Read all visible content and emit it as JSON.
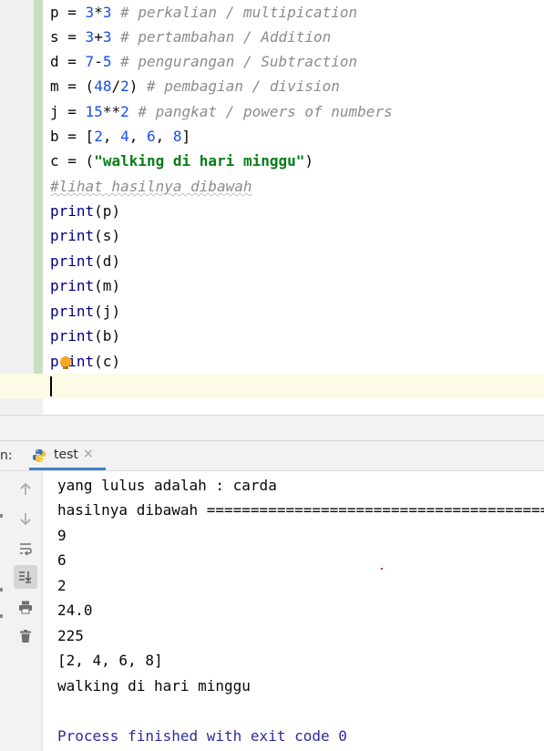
{
  "editor": {
    "lines": [
      {
        "var": "p",
        "eq": " = ",
        "expr_a": "3",
        "op": "*",
        "expr_b": "3",
        "comment": " # perkalian / multipication"
      },
      {
        "var": "s",
        "eq": " = ",
        "expr_a": "3",
        "op": "+",
        "expr_b": "3",
        "comment": " # pertambahan / Addition"
      },
      {
        "var": "d",
        "eq": " = ",
        "expr_a": "7",
        "op": "-",
        "expr_b": "5",
        "comment": " # pengurangan / Subtraction"
      },
      {
        "var": "m",
        "eq": " = ",
        "open": "(",
        "expr_a": "48",
        "op": "/",
        "expr_b": "2",
        "close": ")",
        "comment": " # pembagian / division"
      },
      {
        "var": "j",
        "eq": " = ",
        "expr_a": "15",
        "op": "**",
        "expr_b": "2",
        "comment": " # pangkat / powers of numbers"
      },
      {
        "var": "b",
        "eq": " = ",
        "list_open": "[",
        "items": [
          "2",
          "4",
          "6",
          "8"
        ],
        "list_close": "]"
      },
      {
        "var": "c",
        "eq": " = ",
        "open": "(",
        "string": "\"walking di hari minggu\"",
        "close": ")"
      }
    ],
    "comment_line": "#lihat hasilnya dibawah",
    "print_fn": "print",
    "prints": [
      "(p)",
      "(s)",
      "(d)",
      "(m)",
      "(j)",
      "(b)",
      "(c)"
    ]
  },
  "run_panel": {
    "prefix": "n:",
    "tab_label": "test",
    "tab_close": "×",
    "output": [
      "yang lulus adalah : carda",
      "hasilnya dibawah =======================================",
      "9",
      "6",
      "2",
      "24.0",
      "225",
      "[2, 4, 6, 8]",
      "walking di hari minggu",
      "",
      "Process finished with exit code 0"
    ]
  },
  "icons": {
    "up": "arrow-up-icon",
    "down": "arrow-down-icon",
    "wrap": "soft-wrap-icon",
    "scroll": "scroll-to-end-icon",
    "print": "printer-icon",
    "trash": "trash-icon",
    "python": "python-icon",
    "bulb": "lightbulb-icon"
  },
  "colors": {
    "number": "#1750eb",
    "comment": "#8c8c8c",
    "string": "#067d17",
    "keyword": "#000080",
    "exit_text": "#2c2c9c",
    "tab_underline": "#4083c9"
  }
}
